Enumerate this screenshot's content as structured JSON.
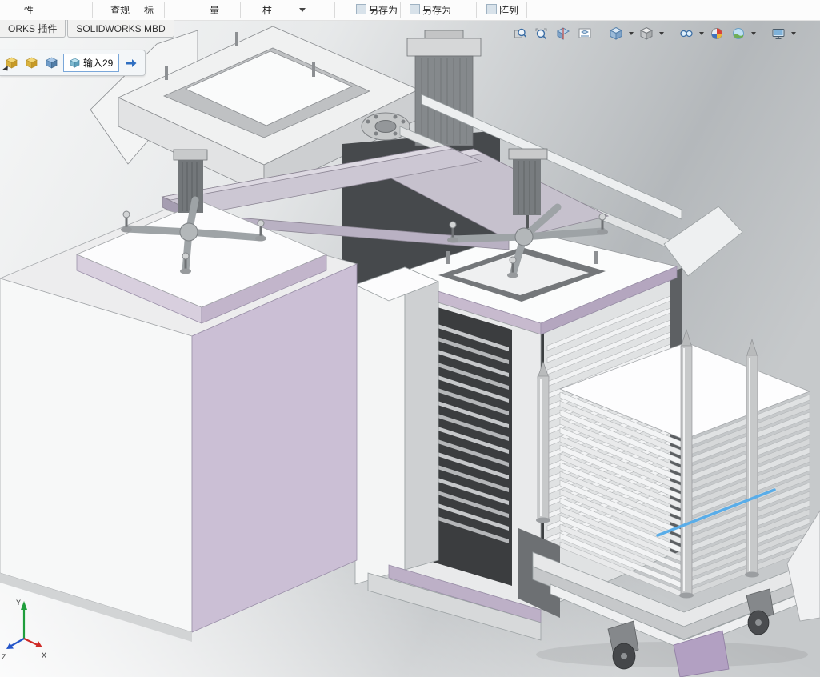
{
  "ribbon": {
    "items": [
      {
        "label": "性"
      },
      {
        "label": "查规"
      },
      {
        "label": "标"
      },
      {
        "label": "量"
      },
      {
        "label": "柱"
      },
      {
        "label": "另存为"
      },
      {
        "label": "另存为"
      },
      {
        "label": "阵列"
      }
    ]
  },
  "tabs": {
    "addins": "ORKS 插件",
    "mbd": "SOLIDWORKS MBD"
  },
  "breadcrumb": {
    "part": "输入29"
  },
  "headsup": {
    "icons": [
      "zoom-to-fit",
      "zoom-to-area",
      "section-view",
      "3d-drawing-view",
      "view-orientation",
      "display-style",
      "hide-show-items",
      "edit-appearance",
      "apply-scene",
      "view-settings"
    ]
  },
  "triad": {
    "x": "X",
    "y": "Y",
    "z": "Z"
  },
  "colors": {
    "selection_highlight": "#59ade9",
    "box_purple": "#cbbfd5",
    "trim_purple": "#c7bace",
    "component_yellow": "#e7c04a",
    "breadcrumb_border": "#7aa7d9"
  }
}
